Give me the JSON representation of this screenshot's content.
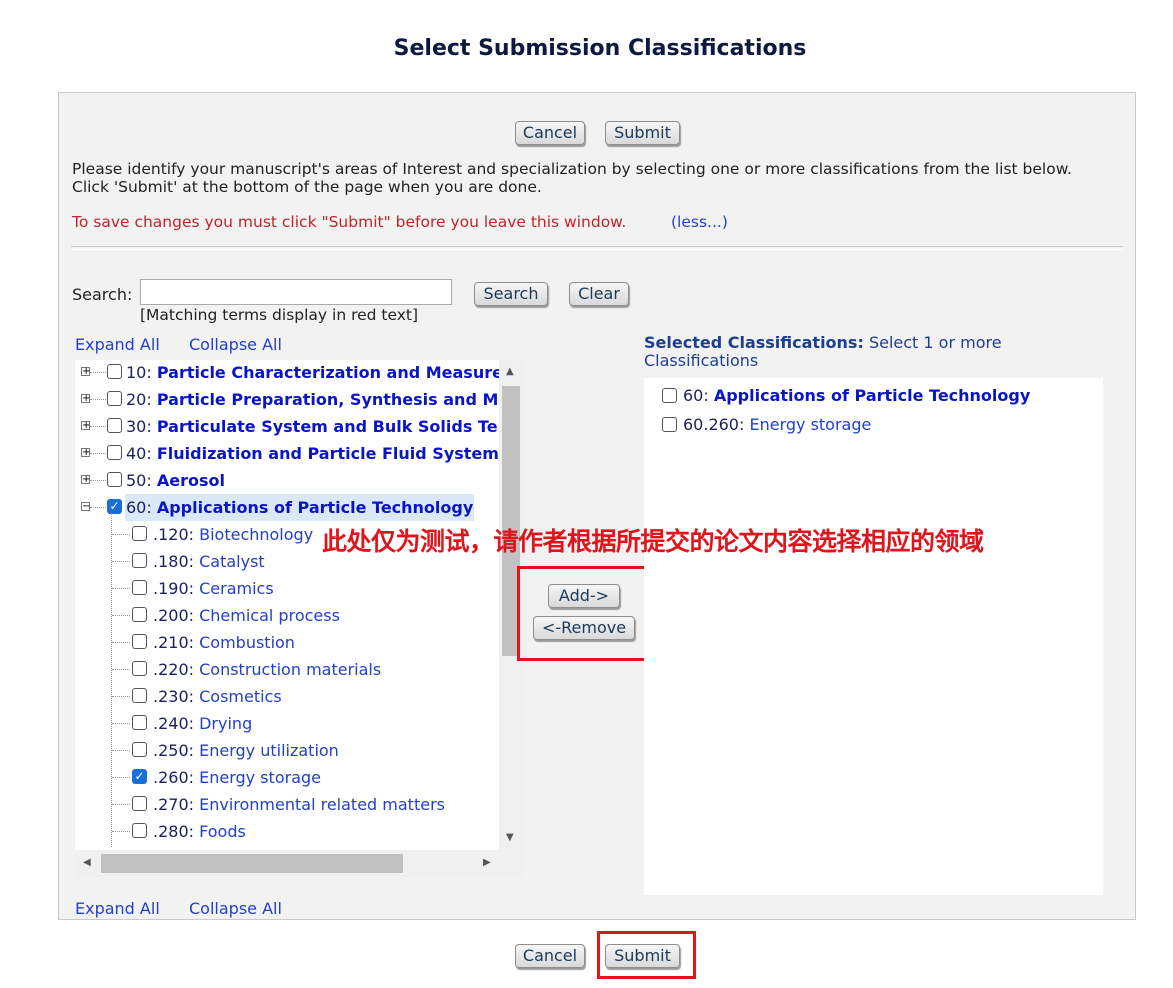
{
  "page": {
    "title": "Select Submission Classifications"
  },
  "top_buttons": {
    "cancel": "Cancel",
    "submit": "Submit"
  },
  "bottom_buttons": {
    "cancel": "Cancel",
    "submit": "Submit"
  },
  "instructions": {
    "line1": "Please identify your manuscript's areas of Interest and specialization by selecting one or more classifications from the list below.",
    "line2": "Click 'Submit' at the bottom of the page when you are done.",
    "warning": "To save changes you must click \"Submit\" before you leave this window.",
    "less_link": "(less...)"
  },
  "search": {
    "label": "Search:",
    "value": "",
    "note": "[Matching terms display in red text]",
    "search_button": "Search",
    "clear_button": "Clear"
  },
  "tree_controls": {
    "expand_all": "Expand All",
    "collapse_all": "Collapse All"
  },
  "tree": {
    "top_level": [
      {
        "code": "10:",
        "label": "Particle Characterization and Measure",
        "checked": false,
        "expander": "+"
      },
      {
        "code": "20:",
        "label": "Particle Preparation, Synthesis and M",
        "checked": false,
        "expander": "+"
      },
      {
        "code": "30:",
        "label": "Particulate System and Bulk Solids Te",
        "checked": false,
        "expander": "+"
      },
      {
        "code": "40:",
        "label": "Fluidization and Particle Fluid System",
        "checked": false,
        "expander": "+"
      },
      {
        "code": "50:",
        "label": "Aerosol",
        "checked": false,
        "expander": "+"
      },
      {
        "code": "60:",
        "label": "Applications of Particle Technology",
        "checked": true,
        "expander": "−"
      }
    ],
    "children": [
      {
        "code": ".120:",
        "label": "Biotechnology",
        "checked": false
      },
      {
        "code": ".180:",
        "label": "Catalyst",
        "checked": false
      },
      {
        "code": ".190:",
        "label": "Ceramics",
        "checked": false
      },
      {
        "code": ".200:",
        "label": "Chemical process",
        "checked": false
      },
      {
        "code": ".210:",
        "label": "Combustion",
        "checked": false
      },
      {
        "code": ".220:",
        "label": "Construction materials",
        "checked": false
      },
      {
        "code": ".230:",
        "label": "Cosmetics",
        "checked": false
      },
      {
        "code": ".240:",
        "label": "Drying",
        "checked": false
      },
      {
        "code": ".250:",
        "label": "Energy utilization",
        "checked": false
      },
      {
        "code": ".260:",
        "label": "Energy storage",
        "checked": true
      },
      {
        "code": ".270:",
        "label": "Environmental related matters",
        "checked": false
      },
      {
        "code": ".280:",
        "label": "Foods",
        "checked": false
      }
    ]
  },
  "transfer": {
    "add": "Add->",
    "remove": "<-Remove"
  },
  "selected": {
    "title_bold": "Selected Classifications:",
    "title_rest": " Select 1 or more Classifications",
    "items": [
      {
        "code": "60:",
        "label": "Applications of Particle Technology",
        "bold": true
      },
      {
        "code": "60.260:",
        "label": "Energy storage",
        "bold": false
      }
    ]
  },
  "annotation": {
    "text": "此处仅为测试，请作者根据所提交的论文内容选择相应的领域"
  },
  "colors": {
    "annotation_red": "#e0151c",
    "link_blue": "#2340c8",
    "bold_blue": "#0a14c8",
    "warning_red": "#c0242a"
  }
}
